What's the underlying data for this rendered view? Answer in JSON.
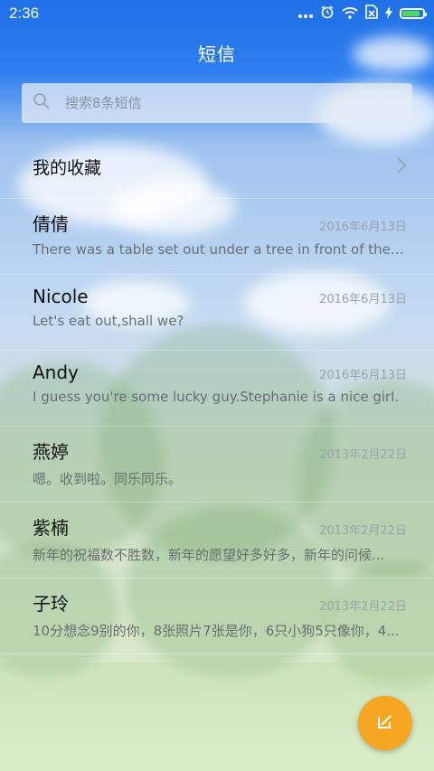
{
  "status_bar": {
    "time": "2:36"
  },
  "header": {
    "title": "短信"
  },
  "search": {
    "placeholder": "搜索8条短信"
  },
  "favorites": {
    "label": "我的收藏"
  },
  "messages": [
    {
      "name": "倩倩",
      "date": "2016年6月13日",
      "preview": "There was a table set out under a tree in front of the ho..."
    },
    {
      "name": "Nicole",
      "date": "2016年6月13日",
      "preview": "Let's eat out,shall we?"
    },
    {
      "name": "Andy",
      "date": "2016年6月13日",
      "preview": "I guess you're some lucky guy.Stephanie is a nice girl."
    },
    {
      "name": "燕婷",
      "date": "2013年2月22日",
      "preview": "嗯。收到啦。同乐同乐。"
    },
    {
      "name": "紫楠",
      "date": "2013年2月22日",
      "preview": "新年的祝福数不胜数，新年的愿望好多好多，新年的问候..."
    },
    {
      "name": "子玲",
      "date": "2013年2月22日",
      "preview": "10分想念9别的你，8张照片7张是你，6只小狗5只像你，4..."
    }
  ],
  "colors": {
    "accent": "#f5a623",
    "header": "#1f6fe6",
    "battery": "#4cd964"
  }
}
